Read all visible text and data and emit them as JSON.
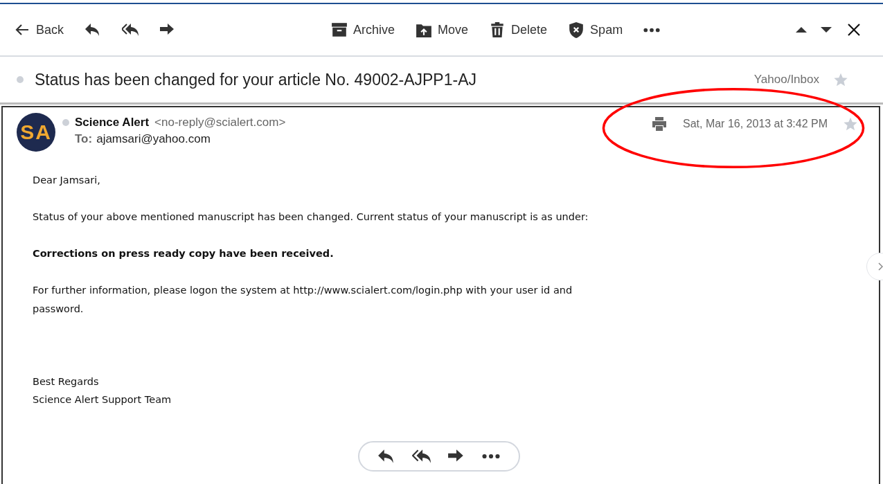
{
  "toolbar": {
    "back": "Back",
    "actions": [
      {
        "kind": "archive",
        "label": "Archive"
      },
      {
        "kind": "move",
        "label": "Move"
      },
      {
        "kind": "delete",
        "label": "Delete"
      },
      {
        "kind": "spam",
        "label": "Spam"
      }
    ]
  },
  "subject": {
    "text": "Status has been changed for your article No. 49002-AJPP1-AJ",
    "folder": "Yahoo/Inbox",
    "starred": false
  },
  "message": {
    "avatar": "SA",
    "sender_name": "Science Alert",
    "sender_email": "<no-reply@scialert.com>",
    "to_label": "To:",
    "to": "ajamsari@yahoo.com",
    "date": "Sat, Mar 16, 2013 at 3:42 PM",
    "starred": false,
    "paragraphs": [
      {
        "kind": "text",
        "text": "Dear Jamsari,"
      },
      {
        "kind": "text",
        "text": "Status of your above mentioned manuscript has been changed. Current status of your manuscript is as under:"
      },
      {
        "kind": "bold",
        "text": "Corrections on press ready copy have been received."
      },
      {
        "kind": "text",
        "text": "For further information, please logon the system at http://www.scialert.com/login.php with your user id and password."
      }
    ],
    "signature": [
      "Best Regards",
      "Science Alert Support Team"
    ]
  }
}
